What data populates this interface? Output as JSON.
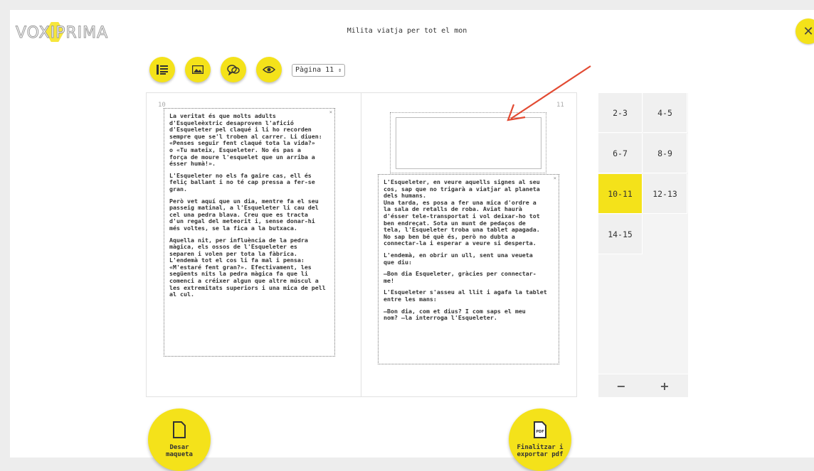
{
  "app": {
    "logo_text": "VOXIPRIMA",
    "document_title": "Milita viatja per tot el mon",
    "close_icon": "close-x-icon"
  },
  "toolbar": {
    "tools": [
      {
        "name": "text-tool",
        "icon": "text-lines-icon"
      },
      {
        "name": "image-tool",
        "icon": "image-icon"
      },
      {
        "name": "speech-bubble-tool",
        "icon": "speech-bubbles-icon"
      },
      {
        "name": "preview-tool",
        "icon": "eye-icon"
      }
    ],
    "page_selector": "Pàgina 11"
  },
  "spread": {
    "left_page_number": "10",
    "right_page_number": "11",
    "left_text": [
      "La veritat és que molts adults\nd'Esqueleèxtric desaproven l'afició\nd'Esqueleter pel claqué i li ho recorden\nsempre que se'l troben al carrer. Li diuen:\n«Penses seguir fent claqué tota la vida?»\no «Tu mateix, Esqueleter. No és pas a\nforça de moure l'esquelet que un arriba a\nésser humà!».",
      "L'Esqueleter no els fa gaire cas, ell és\nfeliç ballant i no té cap pressa a fer-se\ngran.",
      "Però vet aquí que un dia, mentre fa el seu\npasseig matinal, a l'Esqueleter li cau del\ncel una pedra blava. Creu que es tracta\nd'un regal del meteorit i, sense donar-hi\nmés voltes, se la fica a la butxaca.",
      "Aquella nit, per influència de la pedra\nmàgica, els ossos de l'Esqueleter es\nseparen i volen per tota la fàbrica.\nL'endemà tot el cos li fa mal i pensa:\n«M'estaré fent gran?». Efectivament, les\nsegüents nits la pedra màgica fa que li\ncomenci a créixer algun que altre múscul a\nles extremitats superiors i una mica de pell\nal cul."
    ],
    "right_text": [
      "L'Esqueleter, en veure aquells signes al seu\ncos, sap que no trigarà a viatjar al planeta\ndels humans.\nUna tarda, es posa a fer una mica d'ordre a\nla sala de retalls de roba. Aviat haurà\nd'ésser tele-transportat i vol deixar-ho tot\nben endreçat. Sota un munt de pedaços de\ntela, l'Esqueleter troba una tablet apagada.\nNo sap ben bé què és, però no dubta a\nconnectar-la i esperar a veure si desperta.",
      "L'endemà, en obrir un ull, sent una veueta\nque diu:",
      "—Bon dia Esqueleter, gràcies per connectar-\nme!",
      "L'Esqueleter s'asseu al llit i agafa la tablet\nentre les mans:",
      "—Bon dia, com et dius? I com saps el meu\nnom? —la interroga l'Esqueleter."
    ]
  },
  "page_list": {
    "items": [
      "2-3",
      "4-5",
      "6-7",
      "8-9",
      "10-11",
      "12-13",
      "14-15"
    ],
    "active": "10-11",
    "remove_label": "−",
    "add_label": "+"
  },
  "actions": {
    "save_label": "Desar\nmaqueta",
    "finish_label": "Finalitzar i\nexportar pdf",
    "pdf_icon_text": "PDF"
  },
  "colors": {
    "accent": "#f4e21a",
    "arrow": "#e24a32"
  }
}
